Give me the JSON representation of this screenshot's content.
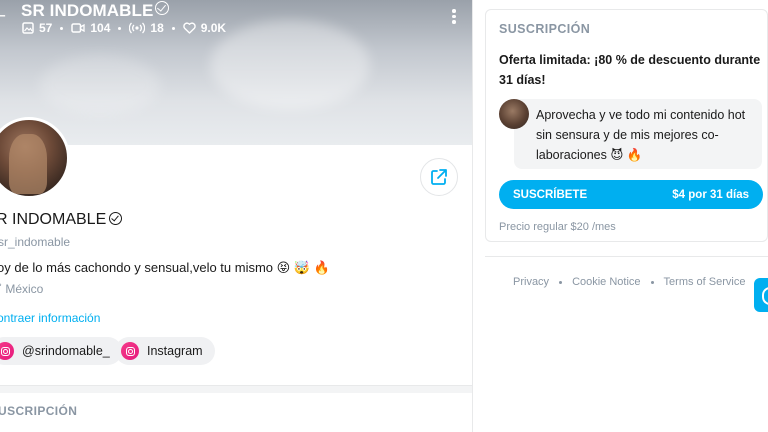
{
  "profile": {
    "name_top": "SR INDOMABLE",
    "stats": {
      "photos": "57",
      "videos": "104",
      "streams": "18",
      "likes": "9.0K"
    },
    "name": "R INDOMABLE",
    "handle": "sr_indomable",
    "bio": "oy de lo más cachondo y sensual,velo tu mismo 😝 🤯 🔥",
    "location": "México",
    "collapse_label": "ontraer información",
    "socials": [
      {
        "label": "@srindomable_"
      },
      {
        "label": "Instagram"
      }
    ],
    "subscription_heading": "USCRIPCIÓN"
  },
  "subscription_card": {
    "title": "SUSCRIPCIÓN",
    "offer": "Oferta limitada: ¡80 % de descuento durante 31 días!",
    "message": "Aprovecha y ve todo mi contenido hot sin sensura y de mis mejores co-laboraciones 😈 🔥",
    "subscribe_label": "SUSCRÍBETE",
    "price_label": "$4 por 31 días",
    "regular_price": "Precio regular $20 /mes"
  },
  "footer": {
    "links": [
      "Privacy",
      "Cookie Notice",
      "Terms of Service"
    ]
  },
  "colors": {
    "accent": "#00aff0",
    "muted": "#8a96a3",
    "instagram": "#e6197c"
  }
}
